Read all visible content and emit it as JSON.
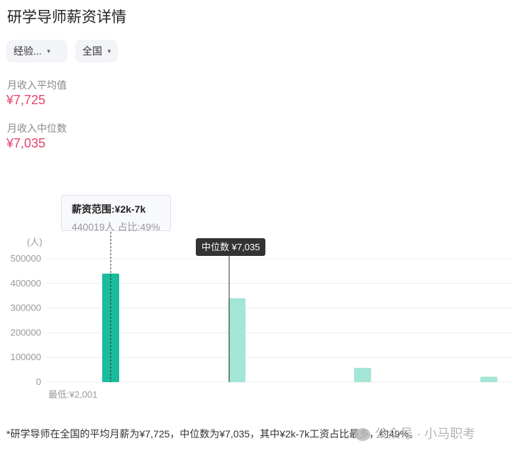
{
  "page": {
    "title": "研学导师薪资详情"
  },
  "filters": {
    "experience": "经验...",
    "region": "全国"
  },
  "stats": {
    "avg_label": "月收入平均值",
    "avg_value": "¥7,725",
    "median_label": "月收入中位数",
    "median_value": "¥7,035"
  },
  "tooltip": {
    "title": "薪资范围:¥2k-7k",
    "body": "440019人  占比:49%"
  },
  "median_marker": {
    "label": "中位数 ¥7,035"
  },
  "colors": {
    "highlight_bar": "#1abc9c",
    "bar": "#a3e6d7",
    "accent": "#e5446d"
  },
  "chart_data": {
    "type": "bar",
    "ylabel": "(人)",
    "ylim": [
      0,
      500000
    ],
    "yticks": [
      "500000",
      "400000",
      "300000",
      "200000",
      "100000",
      "0"
    ],
    "categories": [
      "¥2k-7k",
      "",
      "",
      ""
    ],
    "values": [
      440019,
      340000,
      58000,
      22000
    ],
    "highlight_index": 0,
    "x_min_label": "最低:¥2,001",
    "grid": true
  },
  "footnote": "*研学导师在全国的平均月薪为¥7,725，中位数为¥7,035，其中¥2k-7k工资占比最多，约49%。",
  "watermark": "公众号 · 小马职考"
}
